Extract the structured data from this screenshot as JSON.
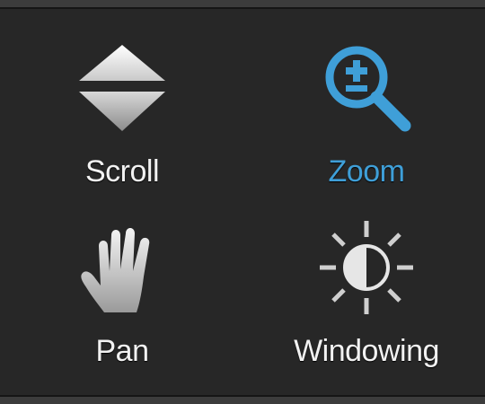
{
  "toolbar": {
    "tools": [
      {
        "label": "Scroll",
        "icon": "scroll-arrows-icon",
        "active": false
      },
      {
        "label": "Zoom",
        "icon": "zoom-magnifier-icon",
        "active": true
      },
      {
        "label": "Pan",
        "icon": "hand-icon",
        "active": false
      },
      {
        "label": "Windowing",
        "icon": "brightness-contrast-icon",
        "active": false
      }
    ]
  },
  "colors": {
    "background": "#272727",
    "label": "#f2f2f2",
    "active_accent": "#3f9fd8",
    "icon_gray": "#cfcfcf"
  }
}
